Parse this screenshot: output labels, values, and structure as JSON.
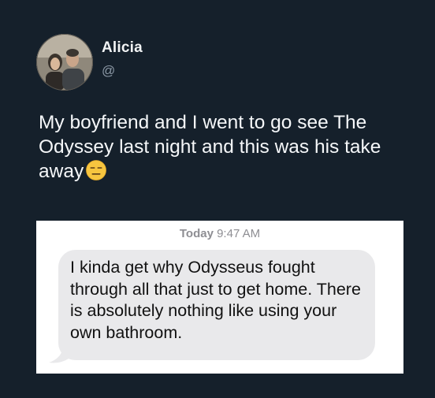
{
  "tweet": {
    "author_name": "Alicia",
    "author_handle": "@",
    "text": "My boyfriend and I went to go see The Odyssey last night and this was his take away",
    "emoji_icon": "expressionless-face-emoji"
  },
  "message_screenshot": {
    "timestamp_day": "Today",
    "timestamp_time": "9:47 AM",
    "message_text": "I kinda get why Odysseus fought through all that just to get home. There is absolutely nothing like using your own bathroom."
  },
  "colors": {
    "background": "#15202b",
    "name_text": "#f2f4f5",
    "handle_text": "#8b98a5",
    "bubble": "#e9e9eb",
    "timestamp": "#8e8e93"
  }
}
